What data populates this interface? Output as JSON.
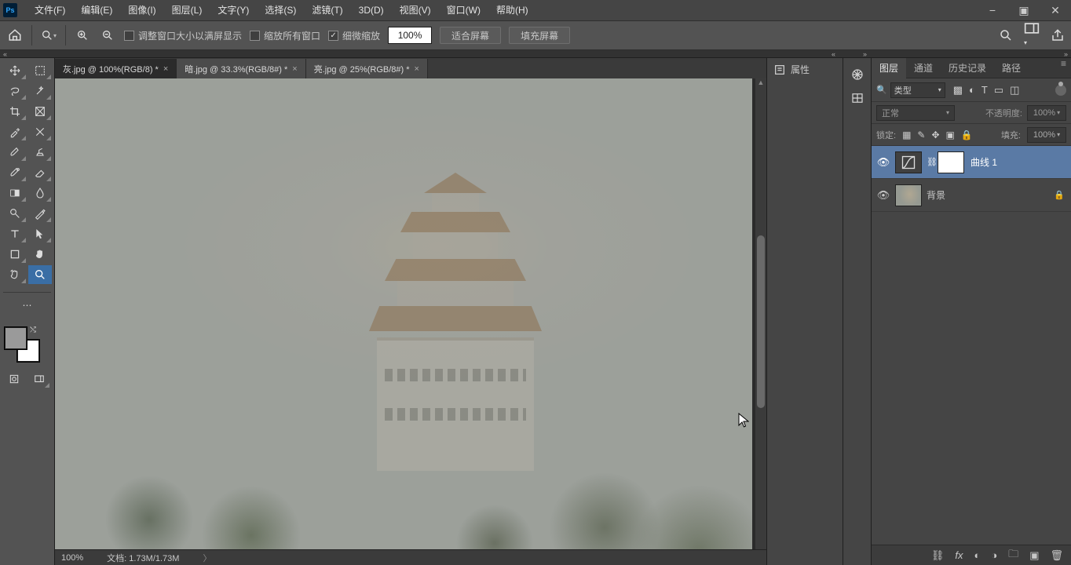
{
  "menubar": {
    "items": [
      "文件(F)",
      "编辑(E)",
      "图像(I)",
      "图层(L)",
      "文字(Y)",
      "选择(S)",
      "滤镜(T)",
      "3D(D)",
      "视图(V)",
      "窗口(W)",
      "帮助(H)"
    ]
  },
  "optionsbar": {
    "resize_window_label": "调整窗口大小以满屏显示",
    "zoom_all_label": "缩放所有窗口",
    "scrubby_zoom_label": "细微缩放",
    "scrubby_zoom_checked": true,
    "zoom_value": "100%",
    "fit_screen_label": "适合屏幕",
    "fill_screen_label": "填充屏幕"
  },
  "tabs": [
    {
      "label": "灰.jpg @ 100%(RGB/8) *",
      "active": true
    },
    {
      "label": "暗.jpg @ 33.3%(RGB/8#) *",
      "active": false
    },
    {
      "label": "亮.jpg @ 25%(RGB/8#) *",
      "active": false
    }
  ],
  "statusbar": {
    "zoom": "100%",
    "doc": "文档: 1.73M/1.73M"
  },
  "swatch": {
    "fg": "#9a9a9a",
    "bg": "#ffffff"
  },
  "mid_panel": {
    "properties_label": "属性"
  },
  "layers_panel": {
    "tabs": [
      "图层",
      "通道",
      "历史记录",
      "路径"
    ],
    "active_tab": 0,
    "filter_label": "类型",
    "blend_mode": "正常",
    "opacity_label": "不透明度:",
    "opacity_value": "100%",
    "lock_label": "锁定:",
    "fill_label": "填充:",
    "fill_value": "100%",
    "layers": [
      {
        "name": "曲线 1",
        "type": "adjustment",
        "adj_icon": "◠",
        "masked": true,
        "visible": true,
        "selected": true,
        "locked": false
      },
      {
        "name": "背景",
        "type": "image",
        "visible": true,
        "selected": false,
        "locked": true
      }
    ]
  }
}
